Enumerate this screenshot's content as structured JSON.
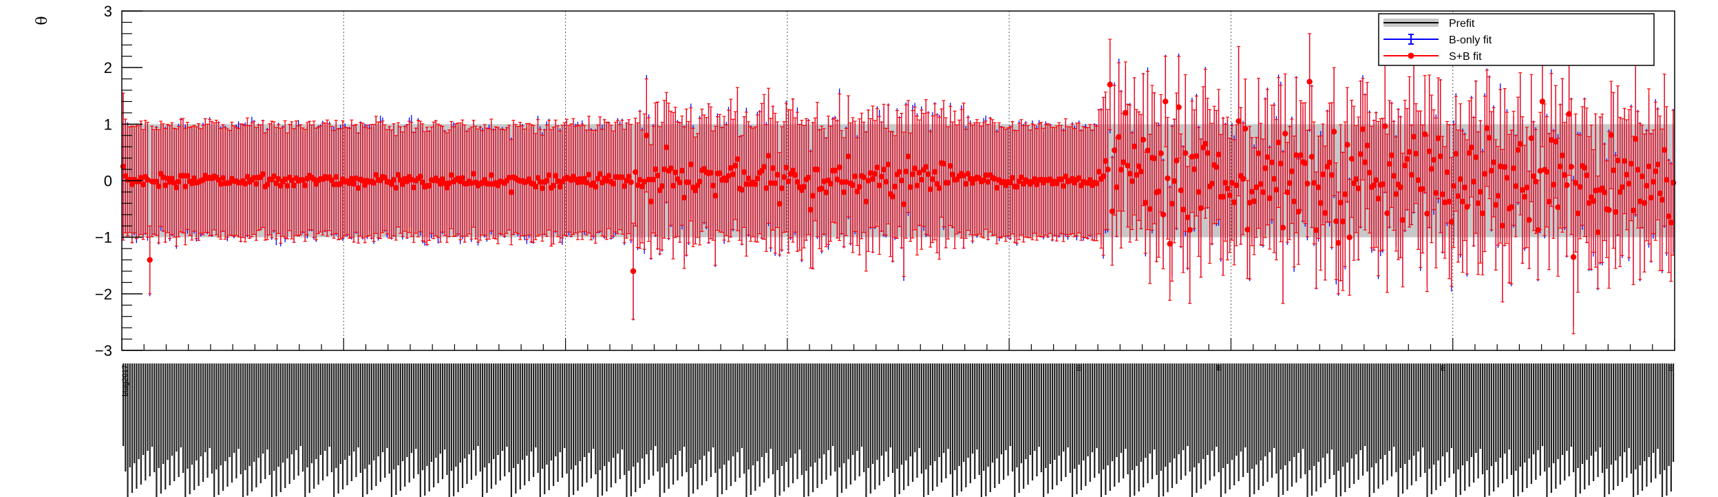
{
  "chart_data": {
    "type": "scatter",
    "title": "",
    "ylabel": "θ",
    "xlabel": "",
    "ylim": [
      -3,
      3
    ],
    "yticks": [
      "3",
      "2",
      "1",
      "0",
      "−1",
      "−2",
      "−3"
    ],
    "grid": "vertical dotted",
    "legend_position": "top-right",
    "prefit_band": [
      -1,
      1
    ],
    "series": [
      {
        "name": "Prefit",
        "style": "band",
        "color": "#c8c8c8",
        "pull": 0,
        "error": 1
      },
      {
        "name": "B-only fit",
        "style": "points-with-errors",
        "color": "#0000ff"
      },
      {
        "name": "S+B fit",
        "style": "points-with-errors",
        "color": "#ff0000"
      }
    ],
    "n_params": 700,
    "visible_x_labels": [
      "btag2017",
      "m",
      "fff",
      "m",
      "m"
    ],
    "highlighted_points": [
      {
        "index": 0,
        "sb_pull": 0.25,
        "sb_err": 1.3
      },
      {
        "index": 12,
        "sb_pull": -1.4,
        "sb_err": 0.6
      },
      {
        "index": 230,
        "sb_pull": -1.6,
        "sb_err": 0.85
      },
      {
        "index": 236,
        "sb_pull": 0.8,
        "sb_err": 1.0
      },
      {
        "index": 445,
        "sb_pull": 1.7,
        "sb_err": 0.8
      },
      {
        "index": 452,
        "sb_pull": 1.2,
        "sb_err": 0.9
      },
      {
        "index": 470,
        "sb_pull": 1.4,
        "sb_err": 0.8
      },
      {
        "index": 476,
        "sb_pull": 1.3,
        "sb_err": 0.9
      },
      {
        "index": 535,
        "sb_pull": 1.75,
        "sb_err": 0.85
      },
      {
        "index": 548,
        "sb_pull": -1.1,
        "sb_err": 0.9
      },
      {
        "index": 640,
        "sb_pull": 1.4,
        "sb_err": 0.8
      }
    ]
  },
  "legend": {
    "prefit": "Prefit",
    "bonly": "B-only fit",
    "sb": "S+B fit"
  }
}
